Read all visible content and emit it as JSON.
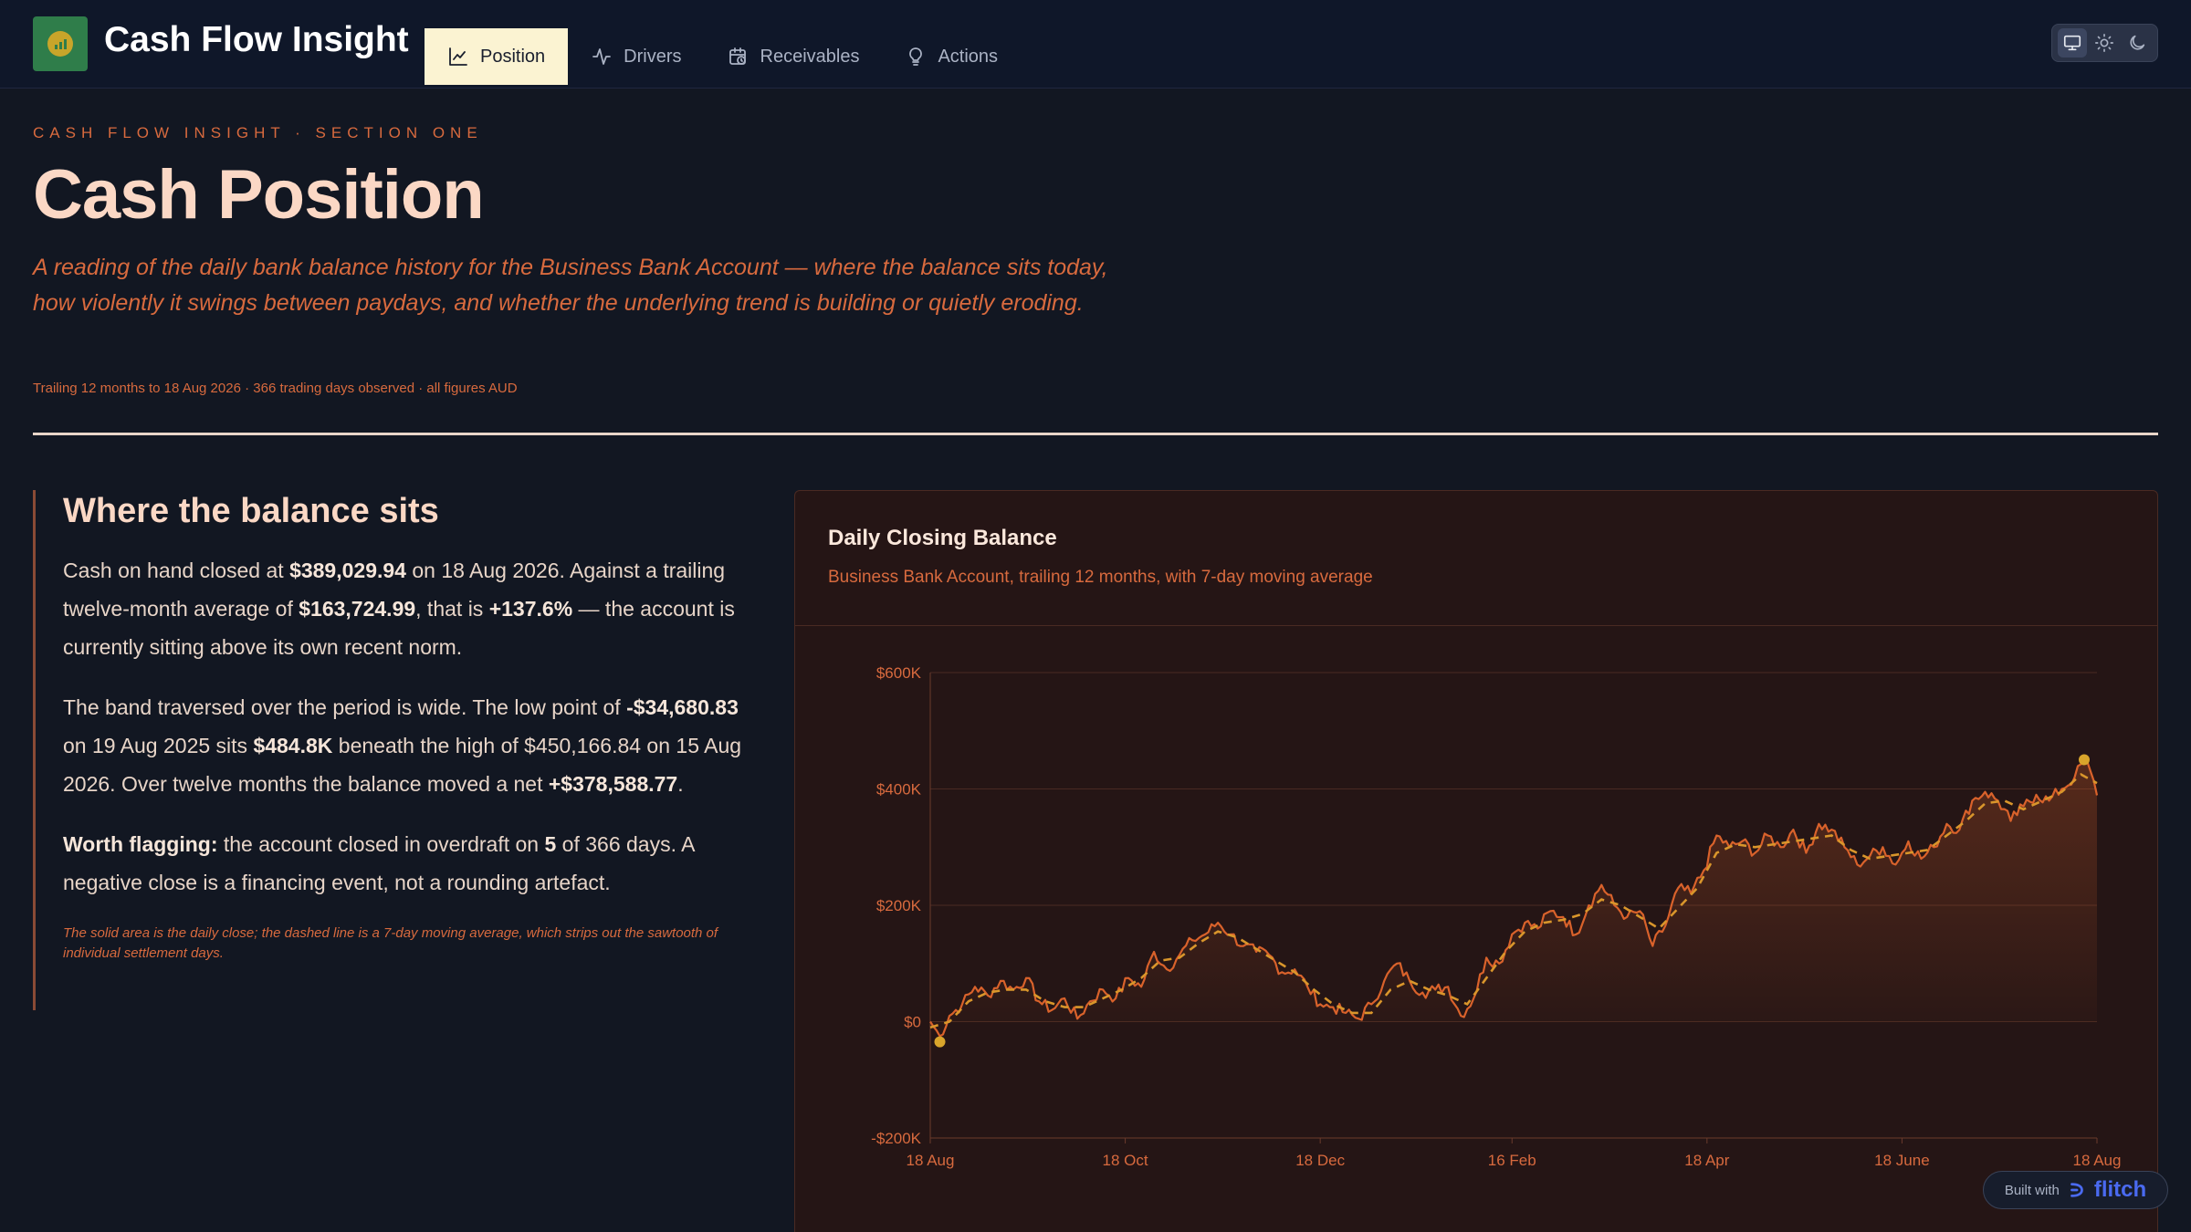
{
  "app": {
    "title": "Cash Flow Insight",
    "logo_icon": "bar-chart-icon",
    "tabs": [
      {
        "label": "Position",
        "icon": "line-chart-icon",
        "active": true
      },
      {
        "label": "Drivers",
        "icon": "activity-icon",
        "active": false
      },
      {
        "label": "Receivables",
        "icon": "calendar-clock-icon",
        "active": false
      },
      {
        "label": "Actions",
        "icon": "lightbulb-icon",
        "active": false
      }
    ],
    "theme_modes": [
      "monitor-icon",
      "sun-icon",
      "moon-icon"
    ],
    "theme_active": "monitor-icon"
  },
  "header": {
    "eyebrow": "CASH FLOW INSIGHT · SECTION ONE",
    "title": "Cash Position",
    "lede": "A reading of the daily bank balance history for the Business Bank Account — where the balance sits today, how violently it swings between paydays, and whether the underlying trend is building or quietly eroding.",
    "meta": "Trailing 12 months to 18 Aug 2026 · 366 trading days observed · all figures AUD"
  },
  "narrative": {
    "heading": "Where the balance sits",
    "p1": {
      "t1": "Cash on hand closed at ",
      "v1": "$389,029.94",
      "t2": " on 18 Aug 2026. Against a trailing twelve-month average of ",
      "v2": "$163,724.99",
      "t3": ", that is ",
      "v3": "+137.6%",
      "t4": " — the account is currently sitting above its own recent norm."
    },
    "p2": {
      "t1": "The band traversed over the period is wide. The low point of ",
      "v1": "-$34,680.83",
      "t2": " on 19 Aug 2025 sits ",
      "v2": "$484.8K",
      "t3": " beneath the high of $450,166.84 on 15 Aug 2026. Over twelve months the balance moved a net ",
      "v3": "+$378,588.77",
      "t4": "."
    },
    "p3": {
      "lead": "Worth flagging:",
      "t1": " the account closed in overdraft on ",
      "v1": "5",
      "t2": " of 366 days. A negative close is a financing event, not a rounding artefact."
    },
    "note": "The solid area is the daily close; the dashed line is a 7-day moving average, which strips out the sawtooth of individual settlement days."
  },
  "card": {
    "title": "Daily Closing Balance",
    "subtitle": "Business Bank Account, trailing 12 months, with 7-day moving average"
  },
  "chart_data": {
    "type": "area",
    "title": "Daily Closing Balance",
    "subtitle": "Business Bank Account, trailing 12 months, with 7-day moving average",
    "colors": {
      "series": "#d9622b",
      "moving_average": "#d9962b",
      "markers": "#d9a52b",
      "grid": "#4a2a22"
    },
    "ylim": [
      -200000,
      600000
    ],
    "yticks": [
      -200000,
      0,
      200000,
      400000,
      600000
    ],
    "ytick_labels": [
      "-$200K",
      "$0",
      "$200K",
      "$400K",
      "$600K"
    ],
    "xticks": [
      "18 Aug",
      "18 Oct",
      "18 Dec",
      "16 Feb",
      "18 Apr",
      "18 June",
      "18 Aug"
    ],
    "xtick_days": [
      0,
      61,
      122,
      182,
      243,
      304,
      365
    ],
    "grid": true,
    "series": [
      {
        "name": "Daily close",
        "points": [
          [
            0,
            0
          ],
          [
            3,
            -25000
          ],
          [
            6,
            10000
          ],
          [
            10,
            30000
          ],
          [
            14,
            60000
          ],
          [
            18,
            45000
          ],
          [
            22,
            70000
          ],
          [
            26,
            55000
          ],
          [
            30,
            75000
          ],
          [
            34,
            35000
          ],
          [
            38,
            20000
          ],
          [
            42,
            40000
          ],
          [
            46,
            5000
          ],
          [
            50,
            35000
          ],
          [
            54,
            55000
          ],
          [
            58,
            40000
          ],
          [
            62,
            75000
          ],
          [
            66,
            60000
          ],
          [
            70,
            120000
          ],
          [
            74,
            90000
          ],
          [
            78,
            115000
          ],
          [
            82,
            140000
          ],
          [
            86,
            150000
          ],
          [
            90,
            170000
          ],
          [
            94,
            150000
          ],
          [
            98,
            130000
          ],
          [
            102,
            120000
          ],
          [
            106,
            115000
          ],
          [
            110,
            85000
          ],
          [
            114,
            90000
          ],
          [
            118,
            60000
          ],
          [
            122,
            30000
          ],
          [
            126,
            25000
          ],
          [
            130,
            15000
          ],
          [
            134,
            5000
          ],
          [
            138,
            30000
          ],
          [
            142,
            70000
          ],
          [
            146,
            100000
          ],
          [
            150,
            70000
          ],
          [
            154,
            50000
          ],
          [
            158,
            55000
          ],
          [
            162,
            60000
          ],
          [
            166,
            10000
          ],
          [
            170,
            40000
          ],
          [
            174,
            110000
          ],
          [
            178,
            100000
          ],
          [
            182,
            150000
          ],
          [
            186,
            170000
          ],
          [
            190,
            160000
          ],
          [
            194,
            190000
          ],
          [
            198,
            180000
          ],
          [
            202,
            150000
          ],
          [
            206,
            200000
          ],
          [
            210,
            235000
          ],
          [
            214,
            200000
          ],
          [
            218,
            180000
          ],
          [
            222,
            190000
          ],
          [
            226,
            130000
          ],
          [
            230,
            165000
          ],
          [
            234,
            230000
          ],
          [
            238,
            220000
          ],
          [
            242,
            260000
          ],
          [
            246,
            320000
          ],
          [
            250,
            300000
          ],
          [
            254,
            310000
          ],
          [
            258,
            290000
          ],
          [
            262,
            320000
          ],
          [
            266,
            300000
          ],
          [
            270,
            330000
          ],
          [
            274,
            290000
          ],
          [
            278,
            340000
          ],
          [
            282,
            330000
          ],
          [
            286,
            300000
          ],
          [
            290,
            270000
          ],
          [
            294,
            285000
          ],
          [
            298,
            300000
          ],
          [
            302,
            270000
          ],
          [
            306,
            310000
          ],
          [
            310,
            280000
          ],
          [
            314,
            300000
          ],
          [
            318,
            340000
          ],
          [
            322,
            330000
          ],
          [
            326,
            380000
          ],
          [
            330,
            395000
          ],
          [
            334,
            380000
          ],
          [
            338,
            345000
          ],
          [
            342,
            370000
          ],
          [
            346,
            390000
          ],
          [
            350,
            380000
          ],
          [
            354,
            400000
          ],
          [
            358,
            420000
          ],
          [
            361,
            450166
          ],
          [
            363,
            430000
          ],
          [
            365,
            389030
          ]
        ]
      },
      {
        "name": "7-day moving average",
        "points": [
          [
            0,
            -10000
          ],
          [
            6,
            0
          ],
          [
            12,
            35000
          ],
          [
            18,
            50000
          ],
          [
            24,
            55000
          ],
          [
            30,
            55000
          ],
          [
            36,
            35000
          ],
          [
            42,
            25000
          ],
          [
            48,
            25000
          ],
          [
            54,
            40000
          ],
          [
            60,
            55000
          ],
          [
            66,
            75000
          ],
          [
            72,
            105000
          ],
          [
            78,
            110000
          ],
          [
            84,
            135000
          ],
          [
            90,
            155000
          ],
          [
            96,
            145000
          ],
          [
            102,
            125000
          ],
          [
            108,
            105000
          ],
          [
            114,
            85000
          ],
          [
            120,
            55000
          ],
          [
            126,
            30000
          ],
          [
            132,
            15000
          ],
          [
            138,
            15000
          ],
          [
            144,
            55000
          ],
          [
            150,
            70000
          ],
          [
            156,
            55000
          ],
          [
            162,
            45000
          ],
          [
            168,
            30000
          ],
          [
            174,
            75000
          ],
          [
            180,
            120000
          ],
          [
            186,
            155000
          ],
          [
            192,
            170000
          ],
          [
            198,
            175000
          ],
          [
            204,
            185000
          ],
          [
            210,
            210000
          ],
          [
            216,
            200000
          ],
          [
            222,
            180000
          ],
          [
            228,
            160000
          ],
          [
            234,
            195000
          ],
          [
            240,
            230000
          ],
          [
            246,
            290000
          ],
          [
            252,
            305000
          ],
          [
            258,
            300000
          ],
          [
            264,
            305000
          ],
          [
            270,
            310000
          ],
          [
            276,
            315000
          ],
          [
            282,
            320000
          ],
          [
            288,
            295000
          ],
          [
            294,
            280000
          ],
          [
            300,
            285000
          ],
          [
            306,
            290000
          ],
          [
            312,
            295000
          ],
          [
            318,
            320000
          ],
          [
            324,
            345000
          ],
          [
            330,
            375000
          ],
          [
            336,
            380000
          ],
          [
            342,
            365000
          ],
          [
            348,
            380000
          ],
          [
            354,
            395000
          ],
          [
            360,
            425000
          ],
          [
            365,
            410000
          ]
        ]
      }
    ],
    "markers": [
      {
        "label": "low",
        "day": 3,
        "value": -34681
      },
      {
        "label": "high",
        "day": 361,
        "value": 450167
      }
    ]
  },
  "badge": {
    "prefix": "Built with",
    "brand": "flitch",
    "icon": "flitch-logo-icon"
  }
}
